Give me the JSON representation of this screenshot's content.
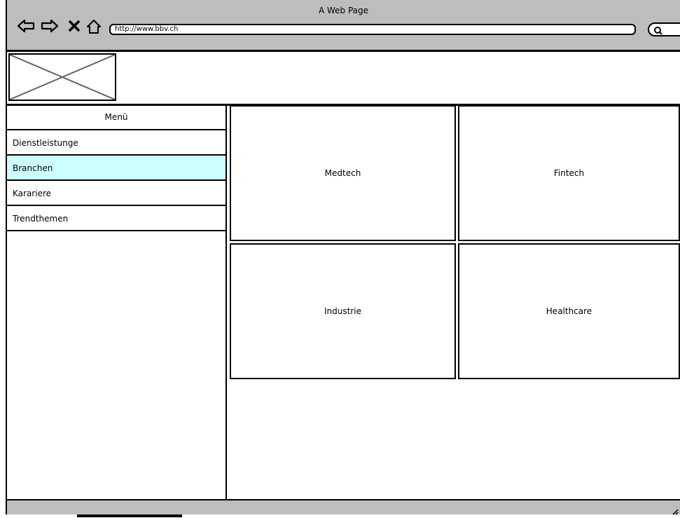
{
  "window": {
    "title": "A Web Page"
  },
  "toolbar": {
    "back_icon": "back-arrow-icon",
    "forward_icon": "forward-arrow-icon",
    "stop_icon": "close-icon",
    "home_icon": "home-icon",
    "url": "http://www.bbv.ch",
    "search_icon": "search-icon"
  },
  "logo": {
    "icon": "image-placeholder-icon"
  },
  "sidebar": {
    "title": "Menü",
    "items": [
      {
        "label": "Dienstleistunge",
        "active": false
      },
      {
        "label": "Branchen",
        "active": true
      },
      {
        "label": "Karariere",
        "active": false
      },
      {
        "label": "Trendthemen",
        "active": false
      }
    ]
  },
  "tiles": [
    {
      "label": "Medtech"
    },
    {
      "label": "Fintech"
    },
    {
      "label": "Industrie"
    },
    {
      "label": "Healthcare"
    }
  ],
  "colors": {
    "chrome": "#bdbdbd",
    "active_item": "#ccffff",
    "border": "#000000"
  }
}
